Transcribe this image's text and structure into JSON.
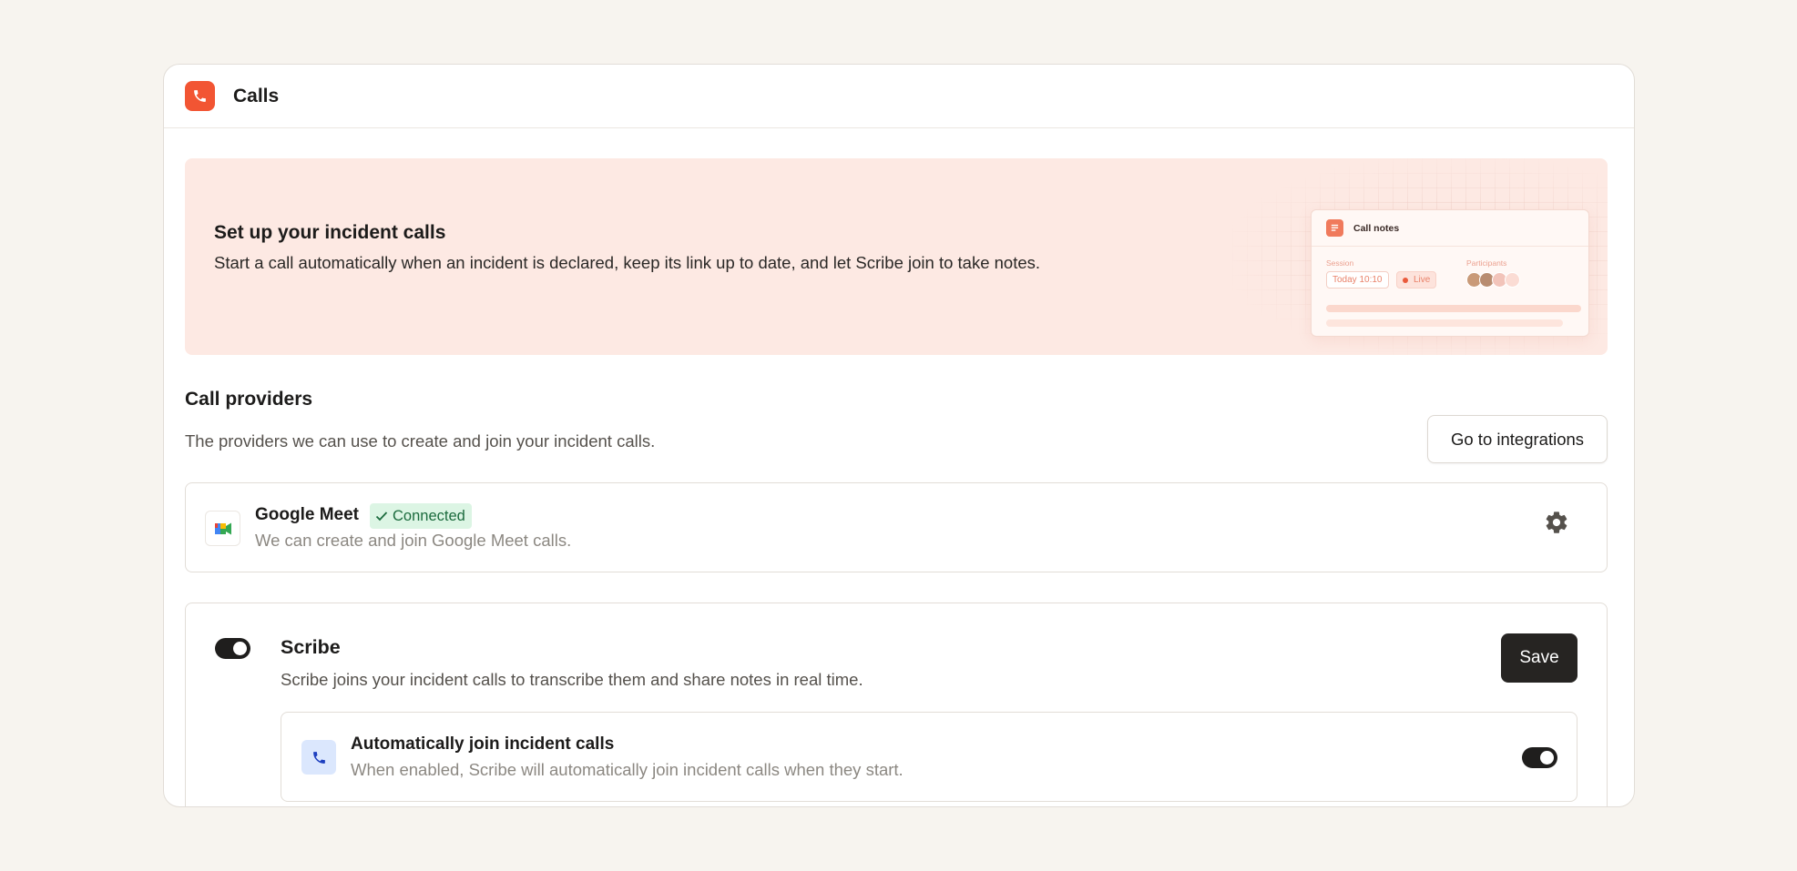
{
  "header": {
    "title": "Calls",
    "icon": "phone-icon",
    "accent": "#f25533"
  },
  "banner": {
    "title": "Set up your incident calls",
    "description": "Start a call automatically when an incident is declared, keep its link up to date, and let Scribe join to take notes.",
    "illustration": {
      "card_title": "Call notes",
      "session_label": "Session",
      "session_time": "Today 10:10",
      "live_label": "Live",
      "participants_label": "Participants"
    }
  },
  "call_providers": {
    "title": "Call providers",
    "description": "The providers we can use to create and join your incident calls.",
    "integrations_button": "Go to integrations",
    "providers": [
      {
        "name": "Google Meet",
        "status": "Connected",
        "status_color": "#1b6b3d",
        "description": "We can create and join Google Meet calls.",
        "icon": "google-meet-icon",
        "settings_icon": "gear-icon"
      }
    ]
  },
  "scribe": {
    "enabled": true,
    "title": "Scribe",
    "description": "Scribe joins your incident calls to transcribe them and share notes in real time.",
    "save_button": "Save",
    "options": [
      {
        "title": "Automatically join incident calls",
        "description": "When enabled, Scribe will automatically join incident calls when they start.",
        "enabled": true,
        "icon": "phone-icon"
      }
    ]
  }
}
